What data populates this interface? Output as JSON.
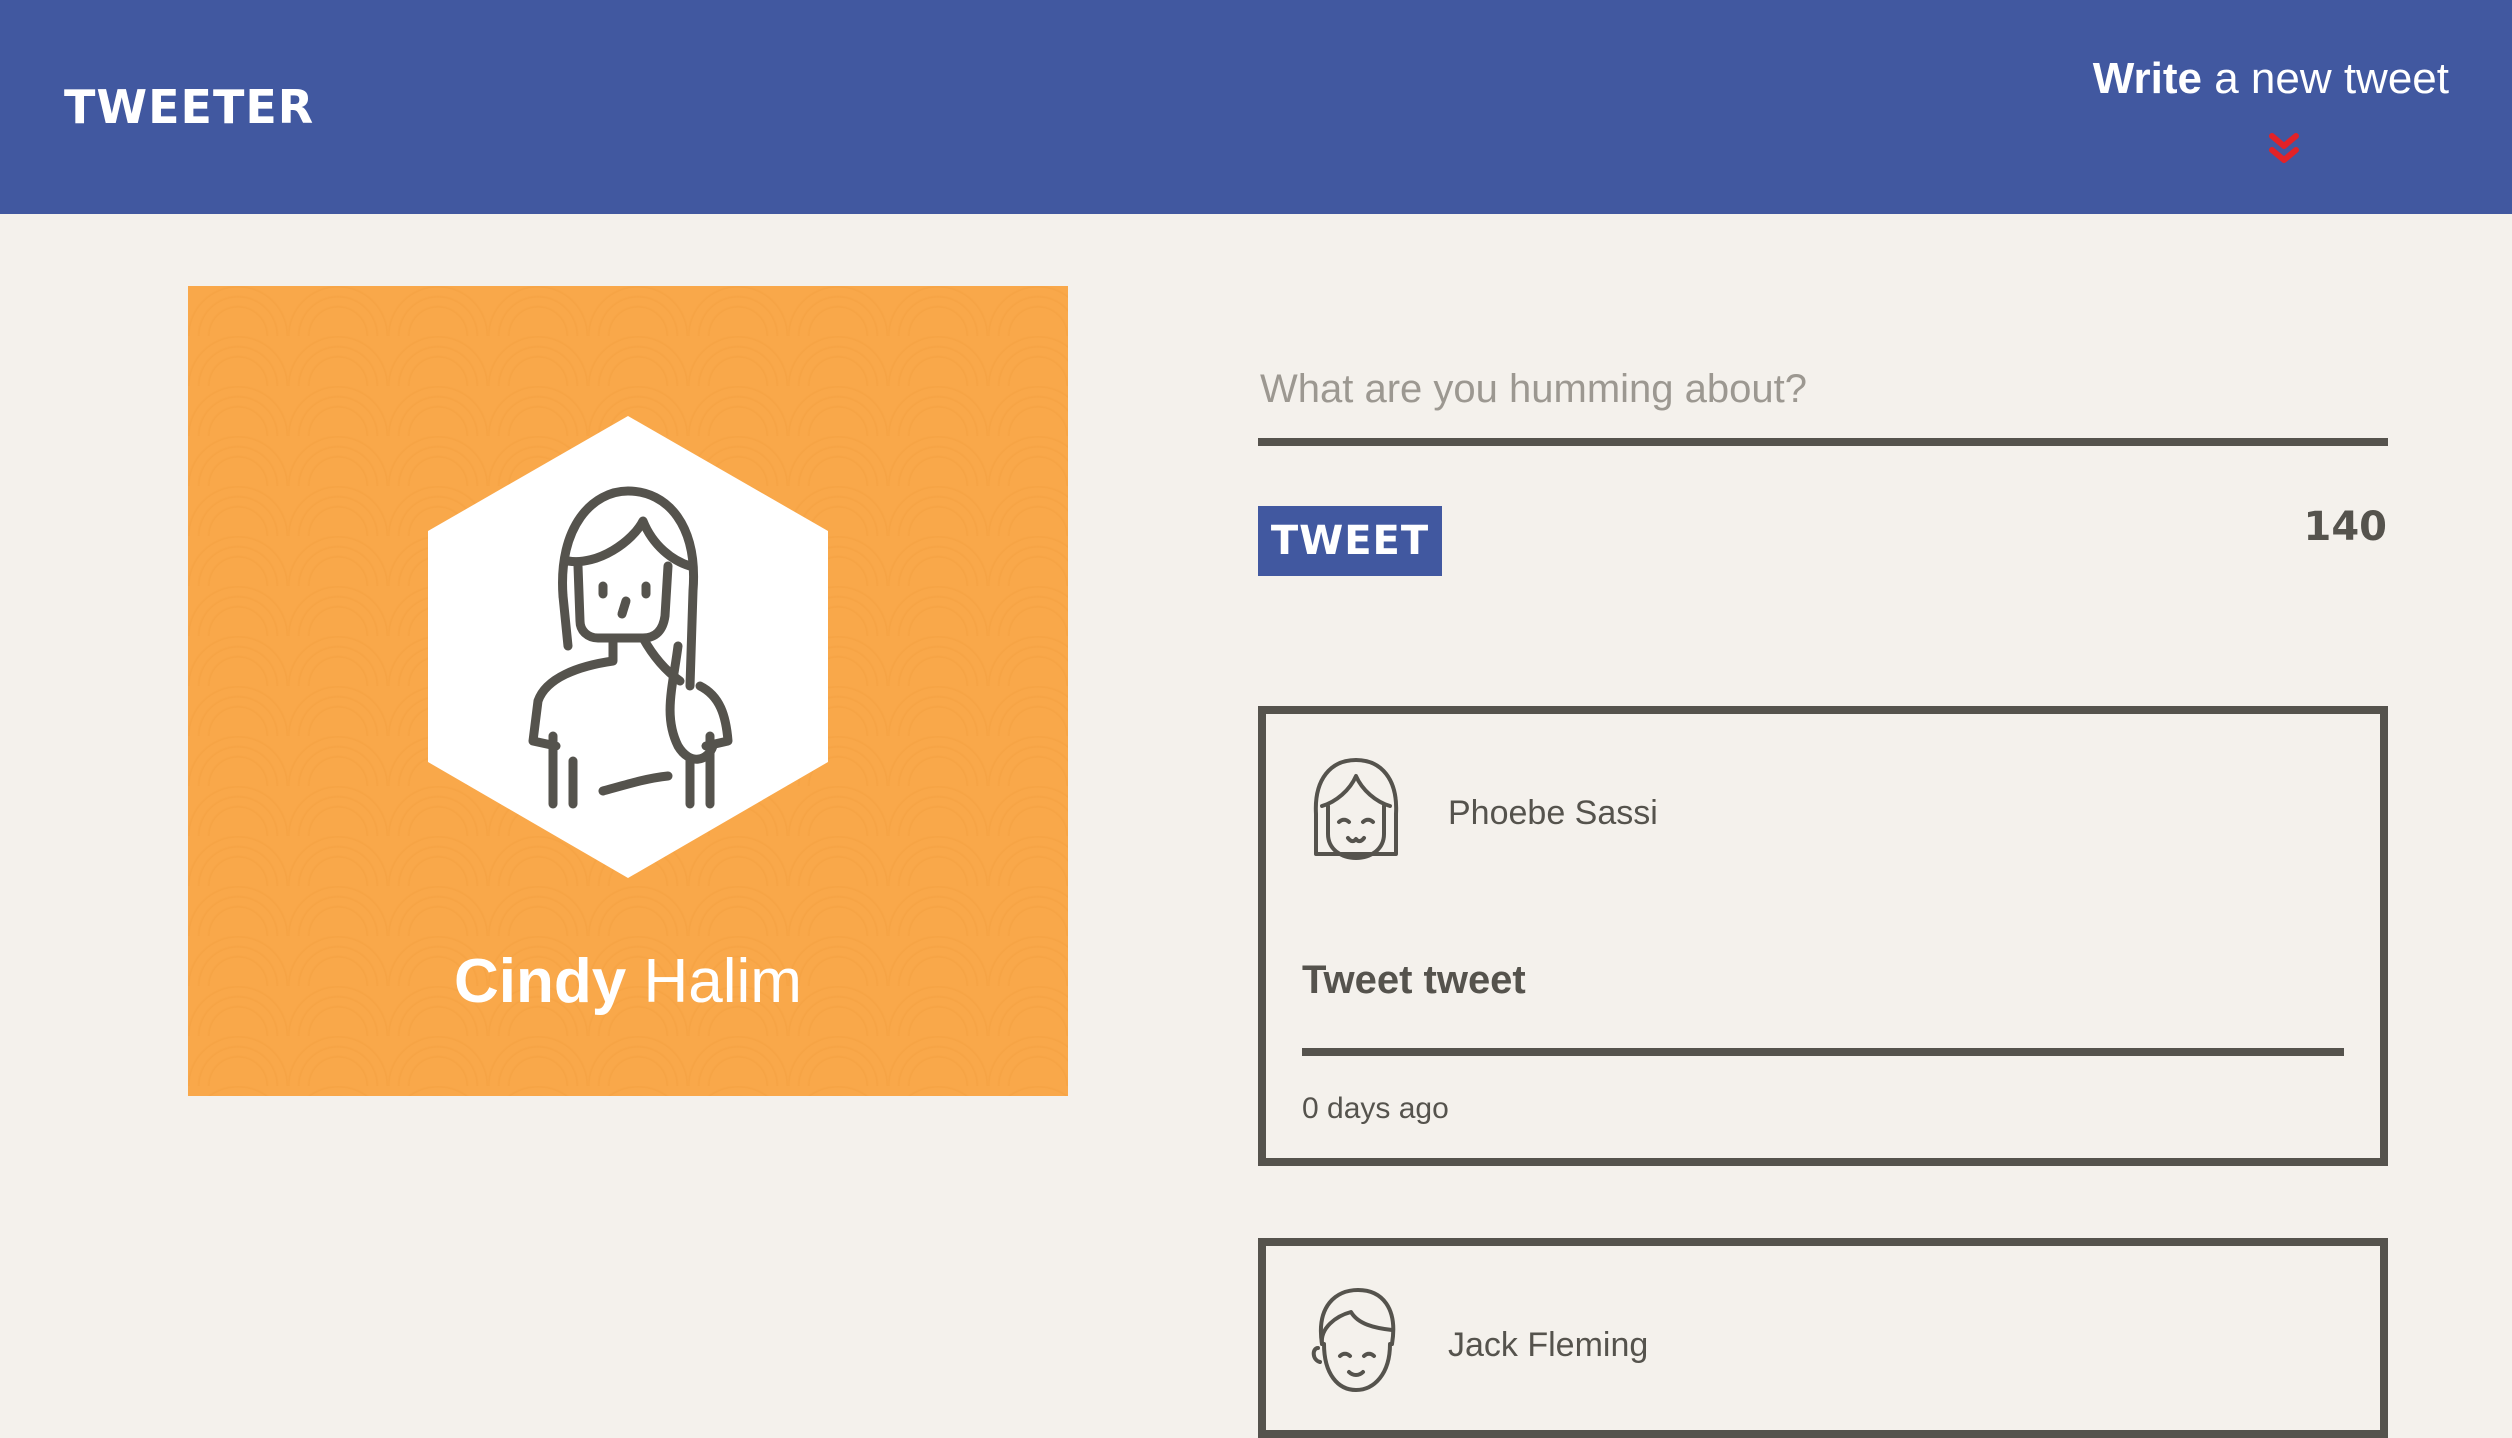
{
  "header": {
    "brand": "TWEETER",
    "compose_toggle_bold": "Write",
    "compose_toggle_rest": " a new tweet",
    "compose_toggle_icon": "double-chevron-down-icon",
    "background": "#4158a0",
    "accent": "#e32227"
  },
  "profile": {
    "first_name": "Cindy",
    "last_name": "Halim",
    "avatar_icon": "woman-avatar-icon",
    "background": "#f9a84a"
  },
  "composer": {
    "placeholder": "What are you humming about?",
    "value": "",
    "button_label": "TWEET",
    "char_counter": "140"
  },
  "tweets": [
    {
      "author": "Phoebe Sassi",
      "avatar_icon": "girl-avatar-icon",
      "text": "Tweet tweet",
      "age": "0 days ago"
    },
    {
      "author": "Jack Fleming",
      "avatar_icon": "boy-avatar-icon",
      "text": "",
      "age": ""
    }
  ]
}
